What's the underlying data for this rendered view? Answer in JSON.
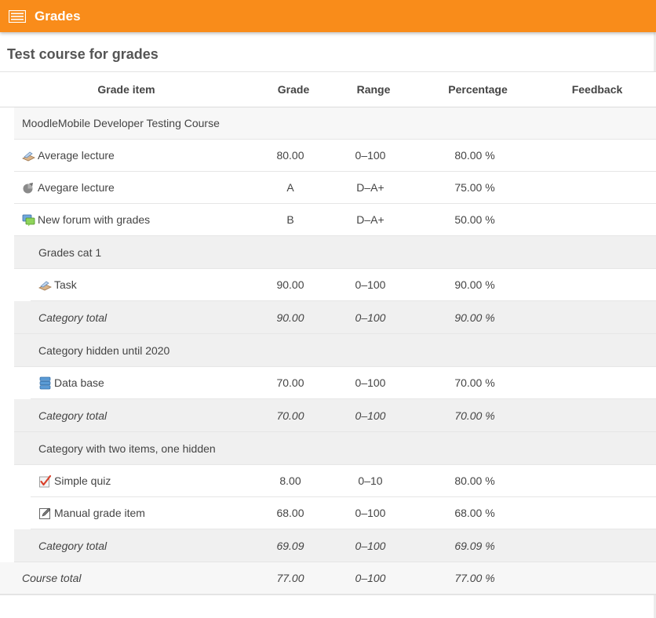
{
  "topbar": {
    "title": "Grades",
    "menu_icon": "menu-icon"
  },
  "course_title": "Test course for grades",
  "columns": {
    "item": "Grade item",
    "grade": "Grade",
    "range": "Range",
    "percentage": "Percentage",
    "feedback": "Feedback"
  },
  "course_name": "MoodleMobile Developer Testing Course",
  "items": [
    {
      "icon": "lesson-icon",
      "name": "Average lecture",
      "grade": "80.00",
      "range": "0–100",
      "percentage": "80.00 %"
    },
    {
      "icon": "quiz-pie-icon",
      "name": "Avegare lecture",
      "grade": "A",
      "range": "D–A+",
      "percentage": "75.00 %"
    },
    {
      "icon": "forum-icon",
      "name": "New forum with grades",
      "grade": "B",
      "range": "D–A+",
      "percentage": "50.00 %"
    }
  ],
  "categories": [
    {
      "name": "Grades cat 1",
      "items": [
        {
          "icon": "lesson-icon",
          "name": "Task",
          "grade": "90.00",
          "range": "0–100",
          "percentage": "90.00 %"
        }
      ],
      "total": {
        "label": "Category total",
        "grade": "90.00",
        "range": "0–100",
        "percentage": "90.00 %"
      }
    },
    {
      "name": "Category hidden until 2020",
      "items": [
        {
          "icon": "database-icon",
          "name": "Data base",
          "grade": "70.00",
          "range": "0–100",
          "percentage": "70.00 %"
        }
      ],
      "total": {
        "label": "Category total",
        "grade": "70.00",
        "range": "0–100",
        "percentage": "70.00 %"
      }
    },
    {
      "name": "Category with two items, one hidden",
      "items": [
        {
          "icon": "quiz-check-icon",
          "name": "Simple quiz",
          "grade": "8.00",
          "range": "0–10",
          "percentage": "80.00 %"
        },
        {
          "icon": "manual-edit-icon",
          "name": "Manual grade item",
          "grade": "68.00",
          "range": "0–100",
          "percentage": "68.00 %"
        }
      ],
      "total": {
        "label": "Category total",
        "grade": "69.09",
        "range": "0–100",
        "percentage": "69.09 %"
      }
    }
  ],
  "course_total": {
    "label": "Course total",
    "grade": "77.00",
    "range": "0–100",
    "percentage": "77.00 %"
  },
  "colors": {
    "accent": "#f98c1a"
  }
}
